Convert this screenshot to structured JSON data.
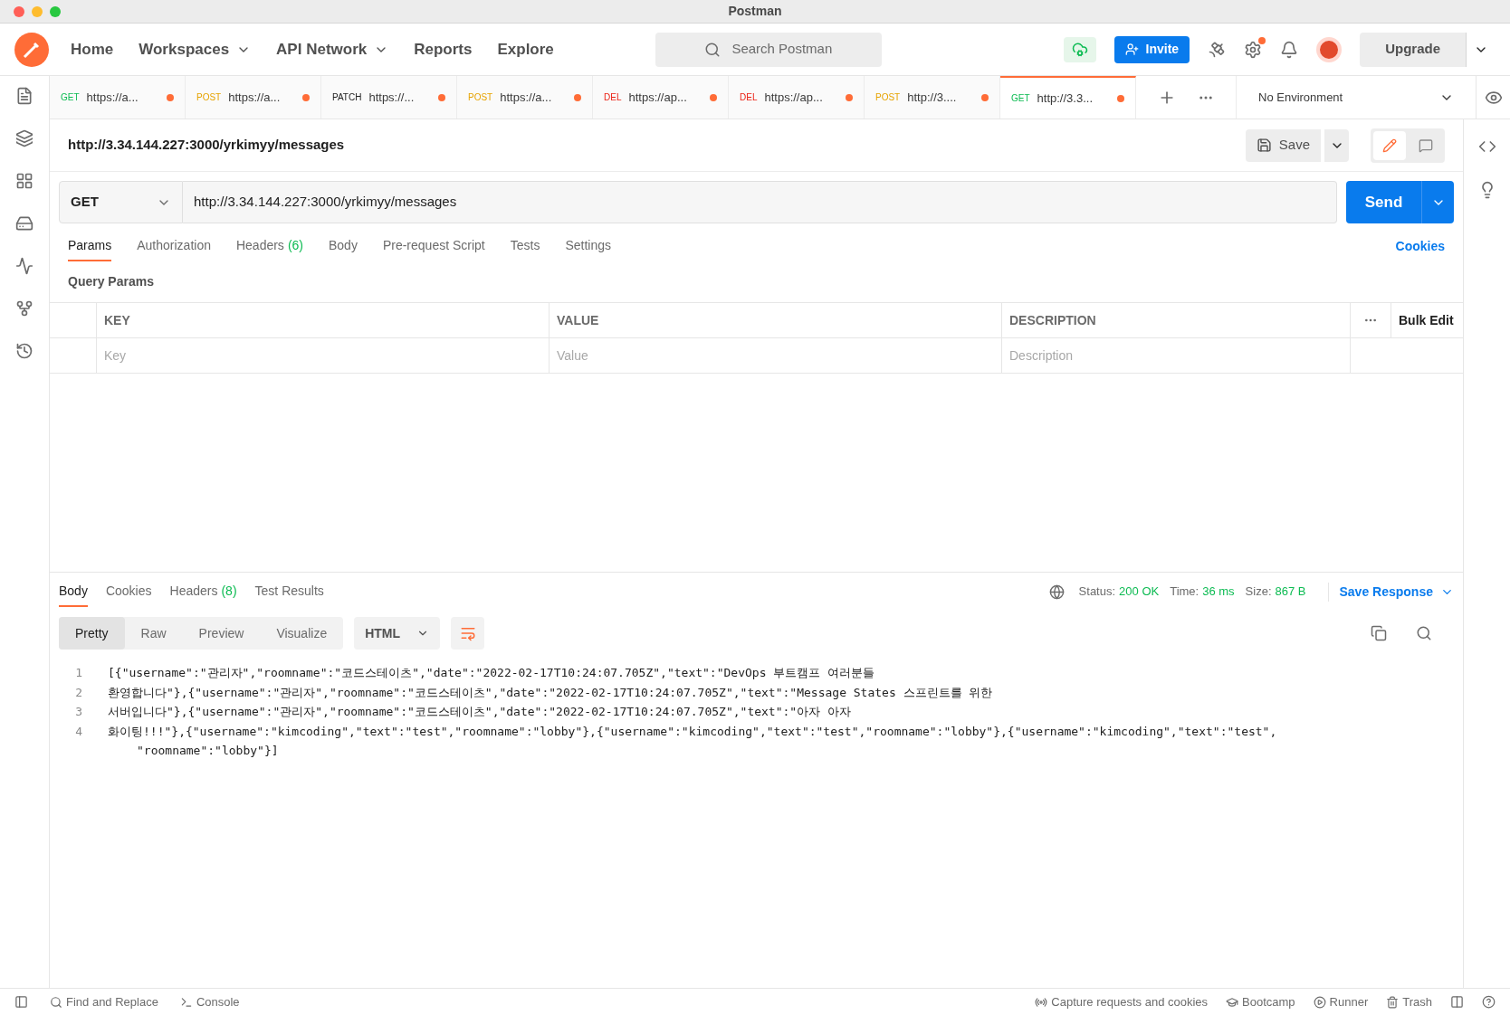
{
  "window": {
    "title": "Postman"
  },
  "nav": {
    "items": [
      {
        "label": "Home",
        "dropdown": false
      },
      {
        "label": "Workspaces",
        "dropdown": true
      },
      {
        "label": "API Network",
        "dropdown": true
      },
      {
        "label": "Reports",
        "dropdown": false
      },
      {
        "label": "Explore",
        "dropdown": false
      }
    ],
    "search": {
      "placeholder": "Search Postman"
    },
    "invite": "Invite",
    "upgrade": "Upgrade"
  },
  "tabs": [
    {
      "method": "GET",
      "url": "https://a...",
      "selected": false
    },
    {
      "method": "POST",
      "url": "https://a...",
      "selected": false
    },
    {
      "method": "PATCH",
      "url": "https://...",
      "selected": false
    },
    {
      "method": "POST",
      "url": "https://a...",
      "selected": false
    },
    {
      "method": "DEL",
      "url": "https://ap...",
      "selected": false
    },
    {
      "method": "DEL",
      "url": "https://ap...",
      "selected": false
    },
    {
      "method": "POST",
      "url": "http://3....",
      "selected": false
    },
    {
      "method": "GET",
      "url": "http://3.3...",
      "selected": true
    }
  ],
  "environment": "No Environment",
  "request": {
    "title": "http://3.34.144.227:3000/yrkimyy/messages",
    "save": "Save",
    "method": "GET",
    "url": "http://3.34.144.227:3000/yrkimyy/messages",
    "send": "Send"
  },
  "request_tabs": [
    {
      "label": "Params",
      "selected": true
    },
    {
      "label": "Authorization",
      "selected": false
    },
    {
      "label": "Headers",
      "count": "(6)",
      "selected": false
    },
    {
      "label": "Body",
      "selected": false
    },
    {
      "label": "Pre-request Script",
      "selected": false
    },
    {
      "label": "Tests",
      "selected": false
    },
    {
      "label": "Settings",
      "selected": false
    }
  ],
  "cookies": "Cookies",
  "query_params": {
    "title": "Query Params",
    "columns": [
      "KEY",
      "VALUE",
      "DESCRIPTION"
    ],
    "bulk_edit": "Bulk Edit",
    "placeholders": [
      "Key",
      "Value",
      "Description"
    ]
  },
  "response": {
    "tabs": [
      {
        "label": "Body",
        "selected": true
      },
      {
        "label": "Cookies",
        "selected": false
      },
      {
        "label": "Headers",
        "count": "(8)",
        "selected": false
      },
      {
        "label": "Test Results",
        "selected": false
      }
    ],
    "status_label": "Status:",
    "status": "200 OK",
    "time_label": "Time:",
    "time": "36 ms",
    "size_label": "Size:",
    "size": "867 B",
    "save_response": "Save Response",
    "views": [
      {
        "label": "Pretty",
        "selected": true
      },
      {
        "label": "Raw",
        "selected": false
      },
      {
        "label": "Preview",
        "selected": false
      },
      {
        "label": "Visualize",
        "selected": false
      }
    ],
    "format": "HTML",
    "lines": [
      {
        "number": "1",
        "text": "[{\"username\":\"관리자\",\"roomname\":\"코드스테이츠\",\"date\":\"2022-02-17T10:24:07.705Z\",\"text\":\"DevOps 부트캠프 여러분들"
      },
      {
        "number": "2",
        "text": "환영합니다\"},{\"username\":\"관리자\",\"roomname\":\"코드스테이츠\",\"date\":\"2022-02-17T10:24:07.705Z\",\"text\":\"Message States 스프린트를 위한"
      },
      {
        "number": "3",
        "text": "서버입니다\"},{\"username\":\"관리자\",\"roomname\":\"코드스테이츠\",\"date\":\"2022-02-17T10:24:07.705Z\",\"text\":\"아자 아자"
      },
      {
        "number": "4",
        "text": "화이팅!!!\"},{\"username\":\"kimcoding\",\"text\":\"test\",\"roomname\":\"lobby\"},{\"username\":\"kimcoding\",\"text\":\"test\",\"roomname\":\"lobby\"},{\"username\":\"kimcoding\",\"text\":\"test\",",
        "continuation": "\"roomname\":\"lobby\"}]"
      }
    ]
  },
  "footer": {
    "left": [
      "Find and Replace",
      "Console"
    ],
    "right": [
      "Capture requests and cookies",
      "Bootcamp",
      "Runner",
      "Trash"
    ]
  }
}
